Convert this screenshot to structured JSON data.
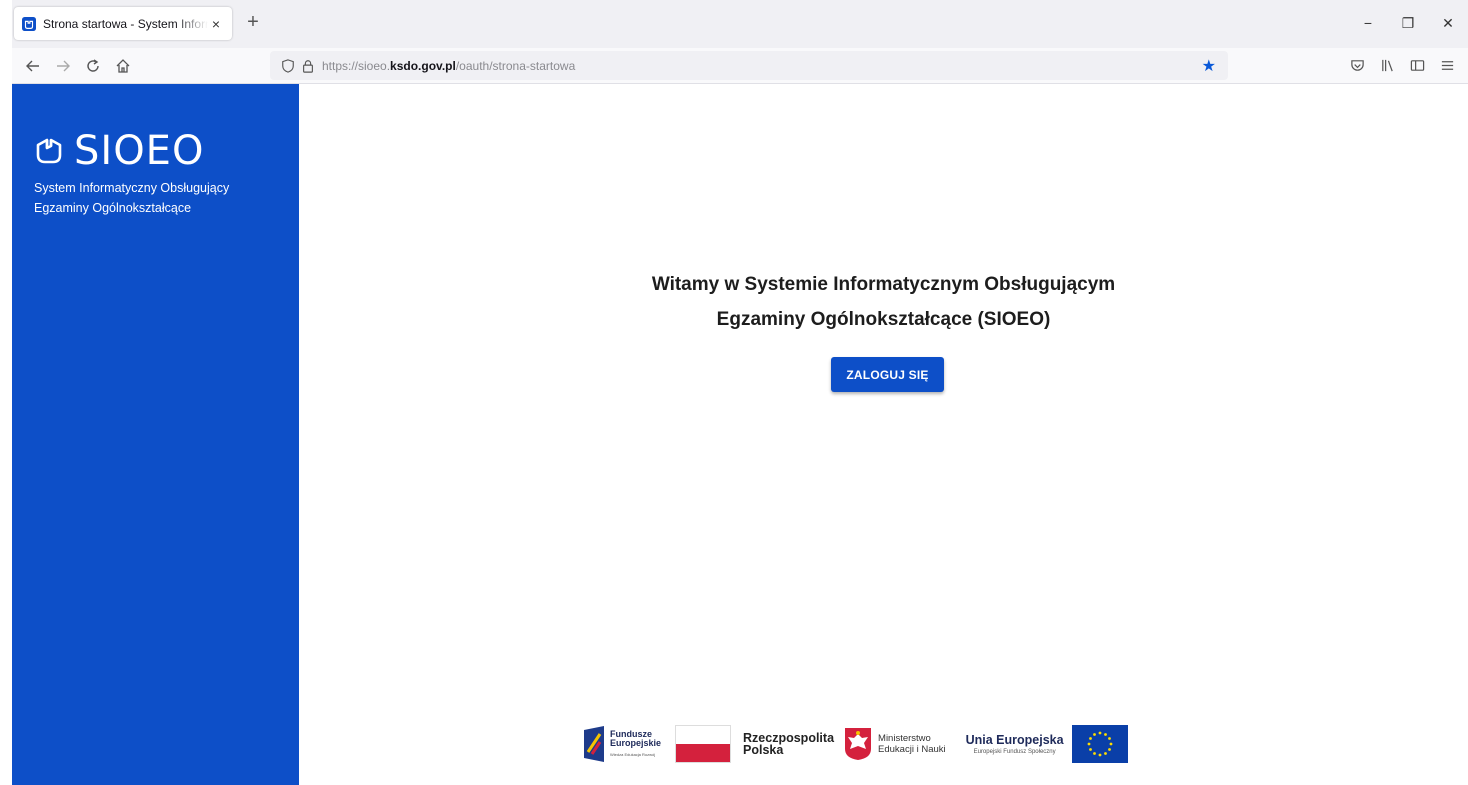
{
  "browser": {
    "tab_title": "Strona startowa - System Informatyczny Obsługujący",
    "tab_close": "×",
    "new_tab": "+",
    "window_controls": {
      "minimize": "−",
      "restore": "❐",
      "close": "✕"
    },
    "url_prefix": "https://sioeo.",
    "url_domain": "ksdo.gov.pl",
    "url_path": "/oauth/strona-startowa",
    "icons": [
      "back-icon",
      "forward-icon",
      "reload-icon",
      "home-icon",
      "shield-icon",
      "lock-icon",
      "bookmark-star-icon",
      "pocket-icon",
      "library-icon",
      "sidebar-icon",
      "menu-icon"
    ]
  },
  "sidebar": {
    "app_name": "SIOEO",
    "subtitle_line1": "System Informatyczny Obsługujący",
    "subtitle_line2": "Egzaminy Ogólnokształcące"
  },
  "main": {
    "welcome_line1": "Witamy w Systemie Informatycznym Obsługującym",
    "welcome_line2": "Egzaminy Ogólnokształcące (SIOEO)",
    "login_label": "ZALOGUJ SIĘ"
  },
  "footer": {
    "fe_line1": "Fundusze",
    "fe_line2": "Europejskie",
    "fe_small": "Wiedza Edukacja Rozwój",
    "rp_line1": "Rzeczpospolita",
    "rp_line2": "Polska",
    "men_line1": "Ministerstwo",
    "men_line2": "Edukacji i Nauki",
    "ue_line1": "Unia Europejska",
    "ue_line2": "Europejski Fundusz Społeczny"
  },
  "colors": {
    "brand_blue": "#0d4fc8",
    "flag_red": "#d4213d",
    "eu_blue": "#0a3fa8",
    "eu_star": "#ffdd00"
  }
}
